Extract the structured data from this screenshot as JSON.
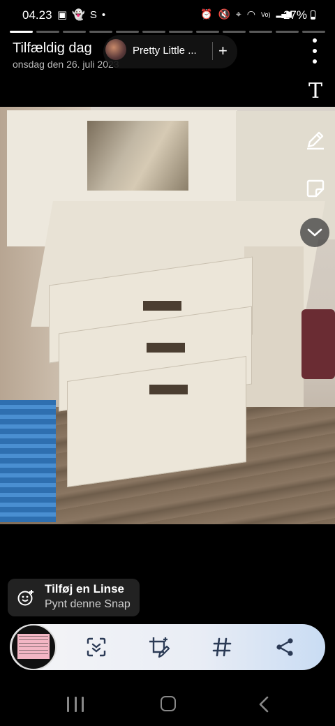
{
  "status_bar": {
    "time": "04.23",
    "left_icons": [
      "image-icon",
      "snapchat-icon",
      "s-icon",
      "dot-icon"
    ],
    "left_glyphs": [
      "▣",
      "👻",
      "S",
      "•"
    ],
    "right_icons": [
      "alarm-icon",
      "mute-icon",
      "location-icon",
      "wifi-icon",
      "volte-icon",
      "signal-icon"
    ],
    "right_glyphs": [
      "⏰",
      "🔇",
      "⌖",
      "◠",
      "Vo)",
      "▂▄▆"
    ],
    "battery": "27%"
  },
  "progress": {
    "segments": 12,
    "active": 1
  },
  "story": {
    "title": "Tilfældig dag",
    "date": "onsdag den 26. juli 2023"
  },
  "sound": {
    "title": "Pretty Little ...",
    "add_label": "+"
  },
  "tools": {
    "text_label": "T"
  },
  "lens": {
    "title": "Tilføj en Linse",
    "subtitle": "Pynt denne Snap"
  },
  "colors": {
    "background": "#000000",
    "action_bar_gradient_end": "#c9dcf3",
    "icon_dark": "#2b3a55"
  }
}
